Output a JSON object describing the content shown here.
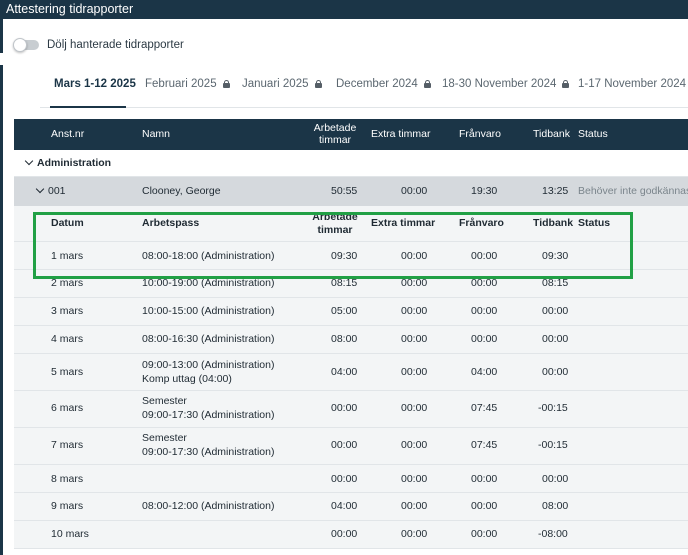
{
  "app": {
    "title": "Attestering tidrapporter"
  },
  "filter": {
    "toggle_label": "Dölj hanterade tidrapporter"
  },
  "tabs": [
    {
      "label": "Mars 1-12 2025",
      "locked": false
    },
    {
      "label": "Februari 2025",
      "locked": true
    },
    {
      "label": "Januari 2025",
      "locked": true
    },
    {
      "label": "December 2024",
      "locked": true
    },
    {
      "label": "18-30 November 2024",
      "locked": true
    },
    {
      "label": "1-17 November 2024",
      "locked": true
    }
  ],
  "table": {
    "headers": {
      "anstnr": "Anst.nr",
      "namn": "Namn",
      "arbetade_l1": "Arbetade",
      "arbetade_l2": "timmar",
      "extra": "Extra timmar",
      "franvaro": "Frånvaro",
      "tidbank": "Tidbank",
      "status": "Status"
    },
    "group": "Administration",
    "employee": {
      "anstnr": "001",
      "namn": "Clooney, George",
      "arbetade": "50:55",
      "extra": "00:00",
      "franvaro": "19:30",
      "tidbank": "13:25",
      "status": "Behöver inte godkännas"
    },
    "detail_headers": {
      "datum": "Datum",
      "arbetspass": "Arbetspass",
      "arbetade_l1": "Arbetade",
      "arbetade_l2": "timmar",
      "extra": "Extra timmar",
      "franvaro": "Frånvaro",
      "tidbank": "Tidbank",
      "status": "Status"
    },
    "rows": [
      {
        "datum": "1 mars",
        "pass1": "08:00-18:00 (Administration)",
        "pass2": "",
        "arbetade": "09:30",
        "extra": "00:00",
        "franvaro": "00:00",
        "tidbank": "09:30"
      },
      {
        "datum": "2 mars",
        "pass1": "10:00-19:00 (Administration)",
        "pass2": "",
        "arbetade": "08:15",
        "extra": "00:00",
        "franvaro": "00:00",
        "tidbank": "08:15"
      },
      {
        "datum": "3 mars",
        "pass1": "10:00-15:00 (Administration)",
        "pass2": "",
        "arbetade": "05:00",
        "extra": "00:00",
        "franvaro": "00:00",
        "tidbank": "00:00"
      },
      {
        "datum": "4 mars",
        "pass1": "08:00-16:30 (Administration)",
        "pass2": "",
        "arbetade": "08:00",
        "extra": "00:00",
        "franvaro": "00:00",
        "tidbank": "00:00"
      },
      {
        "datum": "5 mars",
        "pass1": "09:00-13:00 (Administration)",
        "pass2": "Komp uttag (04:00)",
        "arbetade": "04:00",
        "extra": "00:00",
        "franvaro": "04:00",
        "tidbank": "00:00"
      },
      {
        "datum": "6 mars",
        "pass1": "Semester",
        "pass2": "09:00-17:30 (Administration)",
        "arbetade": "00:00",
        "extra": "00:00",
        "franvaro": "07:45",
        "tidbank": "-00:15"
      },
      {
        "datum": "7 mars",
        "pass1": "Semester",
        "pass2": "09:00-17:30 (Administration)",
        "arbetade": "00:00",
        "extra": "00:00",
        "franvaro": "07:45",
        "tidbank": "-00:15"
      },
      {
        "datum": "8 mars",
        "pass1": "",
        "pass2": "",
        "arbetade": "00:00",
        "extra": "00:00",
        "franvaro": "00:00",
        "tidbank": "00:00"
      },
      {
        "datum": "9 mars",
        "pass1": "08:00-12:00 (Administration)",
        "pass2": "",
        "arbetade": "04:00",
        "extra": "00:00",
        "franvaro": "00:00",
        "tidbank": "08:00"
      },
      {
        "datum": "10 mars",
        "pass1": "",
        "pass2": "",
        "arbetade": "00:00",
        "extra": "00:00",
        "franvaro": "00:00",
        "tidbank": "-08:00"
      }
    ]
  },
  "colors": {
    "header_bg": "#1b3547",
    "employee_row_bg": "#d5d9dd",
    "detail_bg": "#f3f5f6",
    "highlight": "#21a045"
  }
}
